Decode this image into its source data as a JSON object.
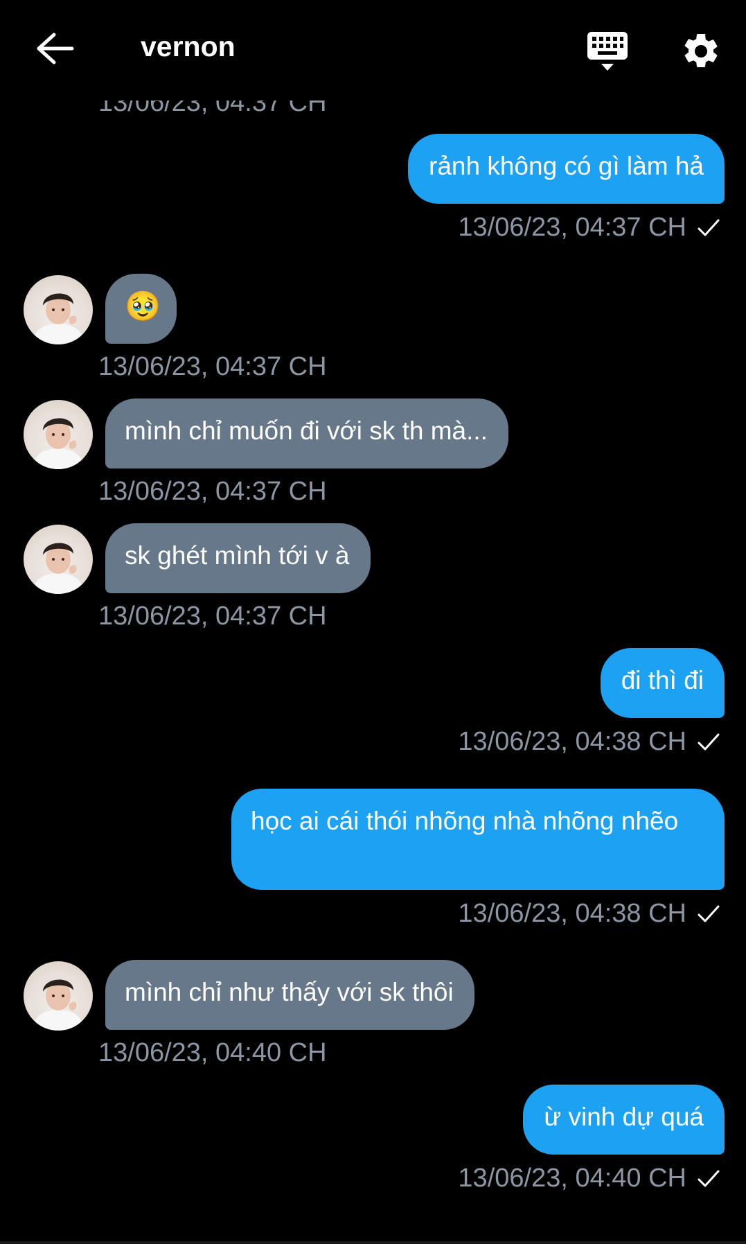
{
  "header": {
    "title": "vernon",
    "partial_timestamp": "13/06/23, 04:37 CH"
  },
  "messages": [
    {
      "direction": "out",
      "text": "rảnh không có gì làm hả",
      "time": "13/06/23, 04:37 CH",
      "status": "check-icon"
    },
    {
      "direction": "in",
      "text": "🥹",
      "time": "13/06/23, 04:37 CH"
    },
    {
      "direction": "in",
      "text": "mình chỉ muốn đi với sk th mà...",
      "time": "13/06/23, 04:37 CH"
    },
    {
      "direction": "in",
      "text": "sk ghét mình tới v à",
      "time": "13/06/23, 04:37 CH"
    },
    {
      "direction": "out",
      "text": "đi thì đi",
      "time": "13/06/23, 04:38 CH",
      "status": "check-icon"
    },
    {
      "direction": "out",
      "text": "học ai cái thói nhõng nhà nhõng nhẽo",
      "time": "13/06/23, 04:38 CH",
      "status": "check-icon"
    },
    {
      "direction": "in",
      "text": "mình chỉ như thấy với sk thôi",
      "time": "13/06/23, 04:40 CH"
    },
    {
      "direction": "out",
      "text": "ừ vinh dự quá",
      "time": "13/06/23, 04:40 CH",
      "status": "check-icon"
    }
  ],
  "colors": {
    "outgoing_bubble": "#1da1f2",
    "incoming_bubble": "#66788a",
    "timestamp": "#8c96a4",
    "background": "#000000"
  }
}
